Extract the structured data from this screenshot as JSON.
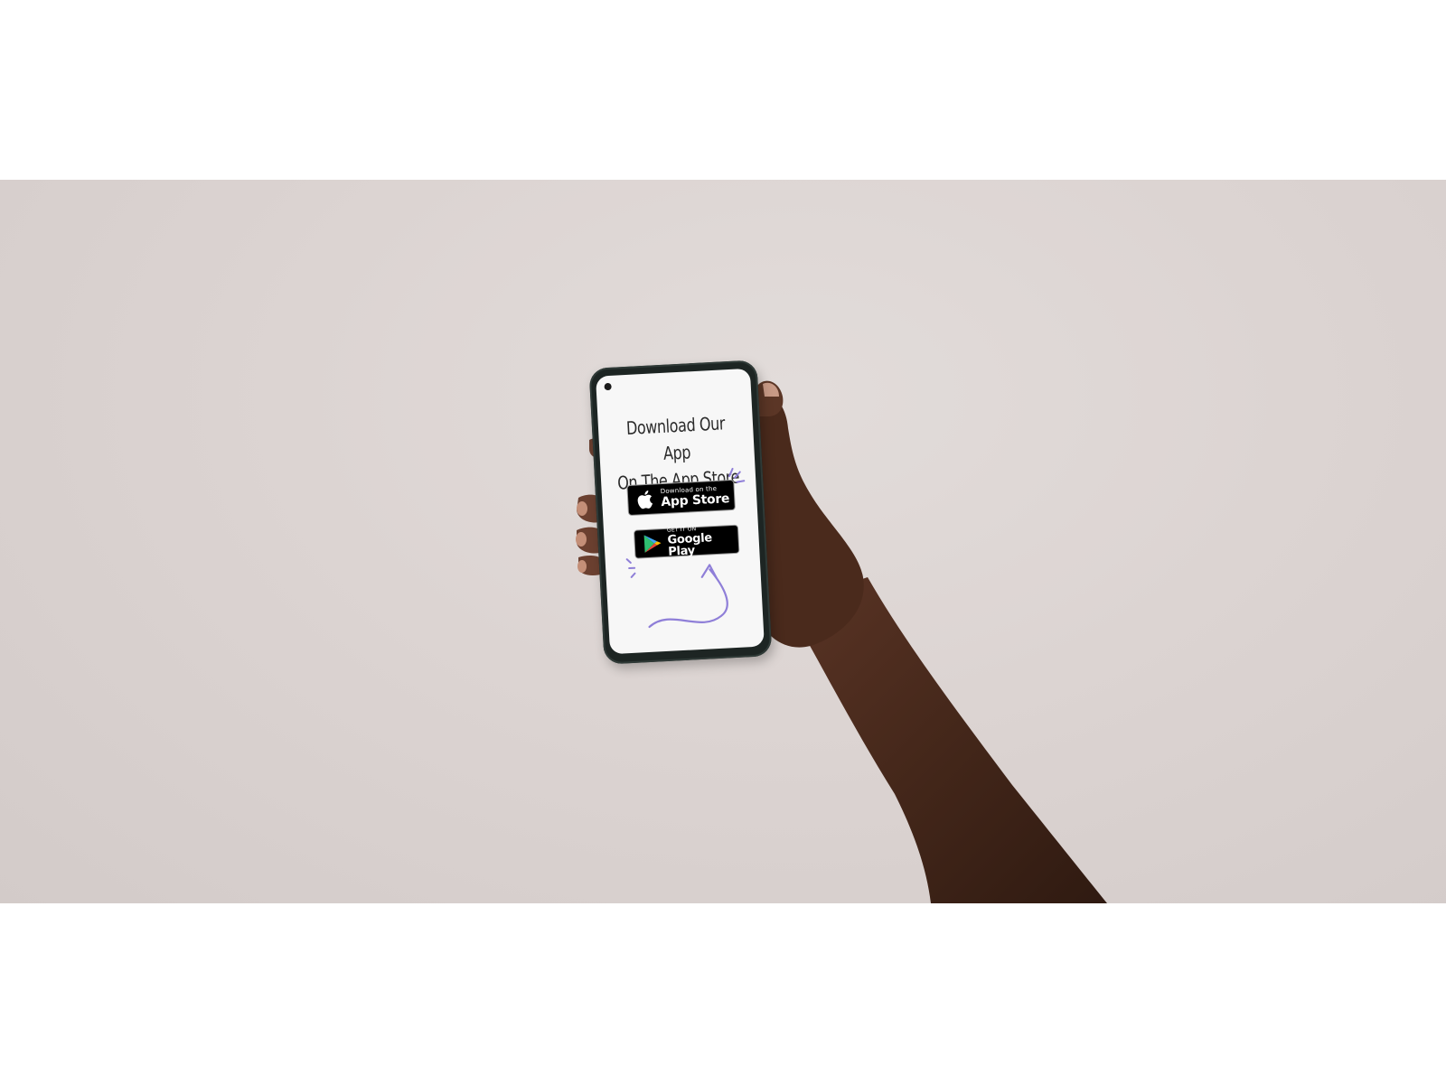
{
  "photo": {
    "background_color": "#d9d1cf",
    "skin_color": "#4a2a1c"
  },
  "phone": {
    "headline_line1": "Download Our App",
    "headline_line2": "On The App Store",
    "app_store_badge": {
      "small_text": "Download on the",
      "large_text": "App Store",
      "icon": "apple-icon"
    },
    "google_play_badge": {
      "small_text": "GET IT ON",
      "large_text": "Google Play",
      "icon": "google-play-icon"
    },
    "accent_color": "#8f7fd8"
  }
}
